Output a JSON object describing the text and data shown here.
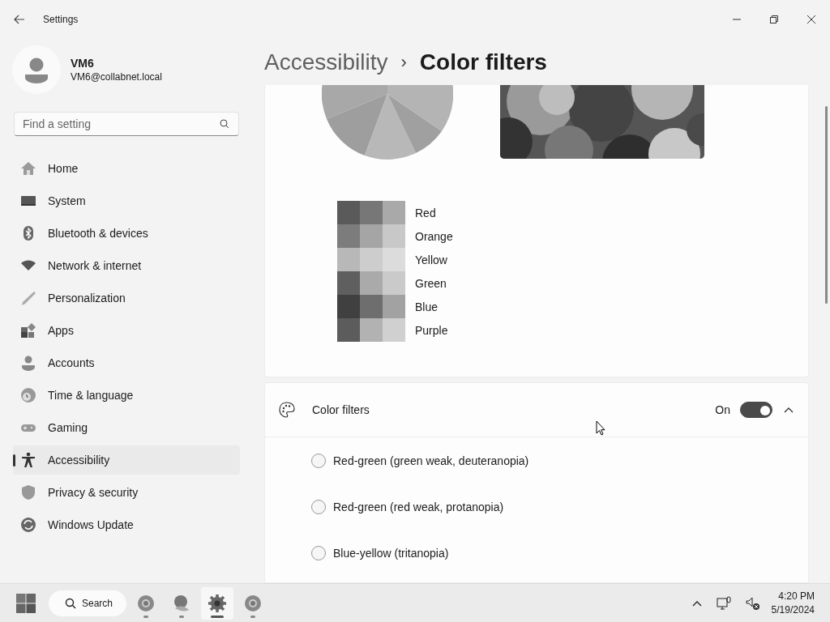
{
  "window": {
    "title": "Settings"
  },
  "user": {
    "name": "VM6",
    "email": "VM6@collabnet.local"
  },
  "search": {
    "placeholder": "Find a setting"
  },
  "nav": [
    {
      "label": "Home",
      "selected": false
    },
    {
      "label": "System",
      "selected": false
    },
    {
      "label": "Bluetooth & devices",
      "selected": false
    },
    {
      "label": "Network & internet",
      "selected": false
    },
    {
      "label": "Personalization",
      "selected": false
    },
    {
      "label": "Apps",
      "selected": false
    },
    {
      "label": "Accounts",
      "selected": false
    },
    {
      "label": "Time & language",
      "selected": false
    },
    {
      "label": "Gaming",
      "selected": false
    },
    {
      "label": "Accessibility",
      "selected": true
    },
    {
      "label": "Privacy & security",
      "selected": false
    },
    {
      "label": "Windows Update",
      "selected": false
    }
  ],
  "breadcrumb": {
    "parent": "Accessibility",
    "separator": "›",
    "current": "Color filters"
  },
  "preview": {
    "swatches": [
      {
        "label": "Red",
        "cells": [
          {
            "color": "#5a5a5a"
          },
          {
            "color": "#777777"
          },
          {
            "color": "#a9a9a9"
          }
        ]
      },
      {
        "label": "Orange",
        "cells": [
          {
            "color": "#7c7c7c"
          },
          {
            "color": "#a5a5a5"
          },
          {
            "color": "#c8c8c8"
          }
        ]
      },
      {
        "label": "Yellow",
        "cells": [
          {
            "color": "#b8b8b8"
          },
          {
            "color": "#cdcdcd"
          },
          {
            "color": "#dcdcdc"
          }
        ]
      },
      {
        "label": "Green",
        "cells": [
          {
            "color": "#5f5f5f"
          },
          {
            "color": "#aaaaaa"
          },
          {
            "color": "#cacaca"
          }
        ]
      },
      {
        "label": "Blue",
        "cells": [
          {
            "color": "#404040"
          },
          {
            "color": "#6e6e6e"
          },
          {
            "color": "#a2a2a2"
          }
        ]
      },
      {
        "label": "Purple",
        "cells": [
          {
            "color": "#5c5c5c"
          },
          {
            "color": "#b2b2b2"
          },
          {
            "color": "#d0d0d0"
          }
        ]
      }
    ]
  },
  "color_filters": {
    "label": "Color filters",
    "state_label": "On",
    "on": true,
    "expanded": true,
    "options": [
      {
        "label": "Red-green (green weak, deuteranopia)",
        "selected": false
      },
      {
        "label": "Red-green (red weak, protanopia)",
        "selected": false
      },
      {
        "label": "Blue-yellow (tritanopia)",
        "selected": false
      }
    ]
  },
  "taskbar": {
    "search_label": "Search",
    "apps": [
      {
        "selected": false
      },
      {
        "selected": false
      },
      {
        "selected": true
      },
      {
        "selected": false
      }
    ],
    "time": "4:20 PM",
    "date": "5/19/2024"
  }
}
